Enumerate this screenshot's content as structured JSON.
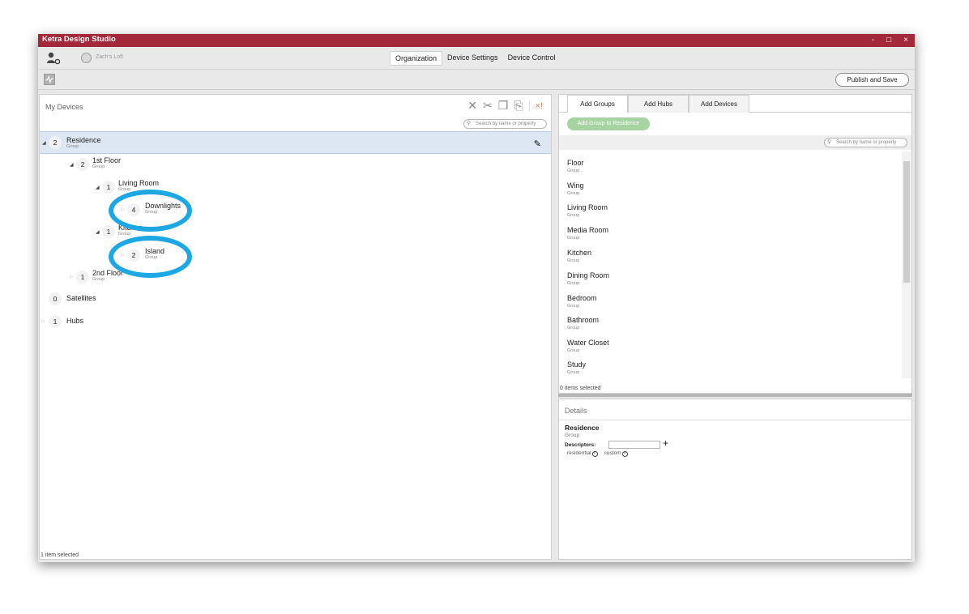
{
  "window": {
    "title": "Ketra Design Studio",
    "controls": [
      "-",
      "□",
      "×"
    ]
  },
  "header": {
    "location": "Zach's Loft",
    "tabs": [
      {
        "label": "Organization",
        "active": true
      },
      {
        "label": "Device Settings",
        "active": false
      },
      {
        "label": "Device Control",
        "active": false
      }
    ],
    "publish_label": "Publish and Save"
  },
  "left": {
    "title": "My Devices",
    "search_placeholder": "Search by name or property",
    "tree": [
      {
        "count": "2",
        "name": "Residence",
        "type": "Group",
        "selected": true,
        "level": 0
      },
      {
        "count": "2",
        "name": "1st Floor",
        "type": "Group",
        "level": 1
      },
      {
        "count": "1",
        "name": "Living Room",
        "type": "Group",
        "level": 2
      },
      {
        "count": "4",
        "name": "Downlights",
        "type": "Group",
        "level": 3,
        "highlighted": true
      },
      {
        "count": "1",
        "name": "Kitchen",
        "type": "Group",
        "level": 2
      },
      {
        "count": "2",
        "name": "Island",
        "type": "Group",
        "level": 3,
        "highlighted": true
      },
      {
        "count": "1",
        "name": "2nd Floor",
        "type": "Group",
        "level": 1
      },
      {
        "count": "0",
        "name": "Satellites",
        "type": "",
        "level": 0
      },
      {
        "count": "1",
        "name": "Hubs",
        "type": "",
        "level": 0
      }
    ],
    "status": "1 item selected"
  },
  "right": {
    "tabs": [
      {
        "label": "Add Groups",
        "active": true
      },
      {
        "label": "Add Hubs",
        "active": false
      },
      {
        "label": "Add Devices",
        "active": false
      }
    ],
    "add_button": "Add Group to Residence",
    "search_placeholder": "Search by name or property",
    "groups": [
      {
        "name": "Floor",
        "type": "Group"
      },
      {
        "name": "Wing",
        "type": "Group"
      },
      {
        "name": "Living Room",
        "type": "Group"
      },
      {
        "name": "Media Room",
        "type": "Group"
      },
      {
        "name": "Kitchen",
        "type": "Group"
      },
      {
        "name": "Dining Room",
        "type": "Group"
      },
      {
        "name": "Bedroom",
        "type": "Group"
      },
      {
        "name": "Bathroom",
        "type": "Group"
      },
      {
        "name": "Water Closet",
        "type": "Group"
      },
      {
        "name": "Study",
        "type": "Group"
      }
    ],
    "status": "0 items selected"
  },
  "details": {
    "title": "Details",
    "name": "Residence",
    "type": "Group",
    "descriptors_label": "Descriptors:",
    "tags": [
      "residential",
      "custom"
    ]
  },
  "colors": {
    "titlebar": "#a2283a",
    "highlight_ring": "#1da8e3",
    "selection": "#dce7f3",
    "add_button": "#a7d3a3"
  }
}
